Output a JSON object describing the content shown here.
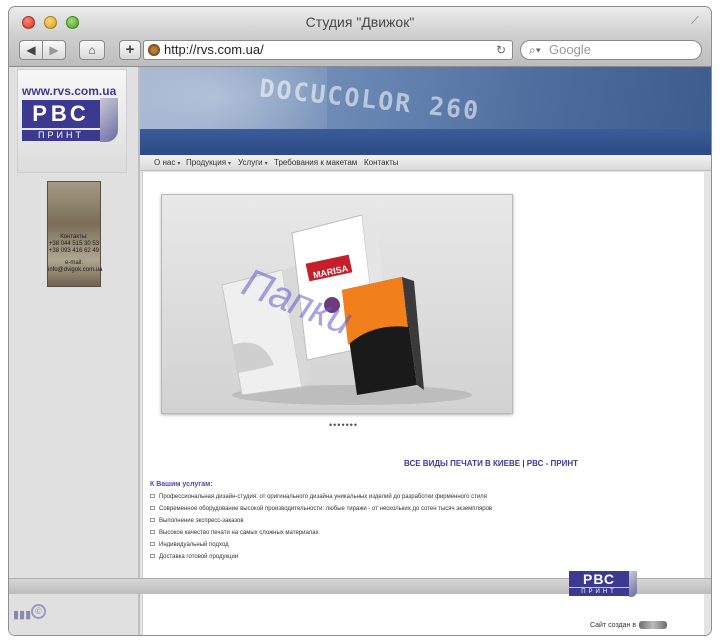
{
  "window": {
    "title": "Студия \"Движок\""
  },
  "toolbar": {
    "back": "◀",
    "forward": "▶",
    "home": "⌂",
    "add": "+",
    "url": "http://rvs.com.ua/",
    "search_placeholder": "Google"
  },
  "sidebar": {
    "site_url": "www.rvs.com.ua",
    "logo_letters": "РВС",
    "logo_sub": "ПРИНТ",
    "contact_card": {
      "label": "Контакты:",
      "phone1": "+38 044 515 30 53",
      "phone2": "+38 093 416 62 49",
      "email_label": "e-mail:",
      "email": "info@dvigok.com.ua"
    }
  },
  "banner": {
    "text": "DOCUCOLOR 260"
  },
  "menu": {
    "items": [
      {
        "label": "О нас",
        "dropdown": true
      },
      {
        "label": "Продукция",
        "dropdown": true
      },
      {
        "label": "Услуги",
        "dropdown": true
      },
      {
        "label": "Требования к макетам",
        "dropdown": false
      },
      {
        "label": "Контакты",
        "dropdown": false
      }
    ]
  },
  "slideshow": {
    "caption": "Папки",
    "brand_tab": "MARISA",
    "dots": "•••••••"
  },
  "main": {
    "headline": "ВСЕ ВИДЫ ПЕЧАТИ В КИЕВЕ | РВС - ПРИНТ",
    "services_title": "К Вашим услугам:",
    "services": [
      "Профессиональная дизайн-студия: от оригинального дизайна уникальных изделий до разработки фирменного стиля",
      "Современное оборудование высокой производительности: любые тиражи - от нескольких до сотен тысяч экземпляров",
      "Выполнение экспресс-заказов",
      "Высокое качество печати на самых сложных материалах",
      "Индивидуальный подход",
      "Доставка готовой продукции"
    ]
  },
  "footer": {
    "logo_letters": "РВС",
    "logo_sub": "ПРИНТ",
    "made_by": "Сайт создан в",
    "copyright_symbol": "©"
  },
  "colors": {
    "brand": "#3c3990",
    "accent": "#4c48b0",
    "banner": "#4d6d9e"
  }
}
